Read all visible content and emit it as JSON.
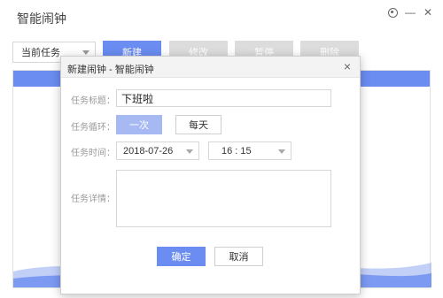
{
  "app": {
    "title": "智能闹钟"
  },
  "toolbar": {
    "filter_value": "当前任务",
    "new_label": "新建",
    "edit_label": "修改",
    "pause_label": "暂停",
    "delete_label": "删除"
  },
  "dialog": {
    "title": "新建闹钟 - 智能闹钟",
    "close_glyph": "×",
    "fields": {
      "title_label": "任务标题：",
      "title_value": "下班啦",
      "cycle_label": "任务循环：",
      "cycle_options": [
        "一次",
        "每天"
      ],
      "cycle_selected": "一次",
      "time_label": "任务时间：",
      "date_value": "2018-07-26",
      "time_value": "16 : 15",
      "detail_label": "任务详情：",
      "detail_value": ""
    },
    "ok_label": "确定",
    "cancel_label": "取消"
  },
  "icons": {
    "settings": "gear-icon",
    "close": "close-icon"
  },
  "colors": {
    "accent": "#6b8cf0",
    "accent_light": "#a7b9f3",
    "disabled": "#dcdcdc"
  }
}
